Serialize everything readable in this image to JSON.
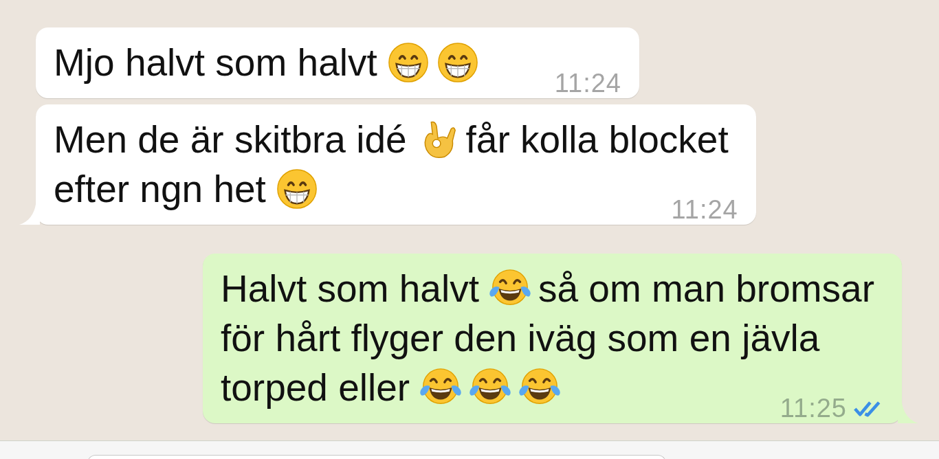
{
  "messages": [
    {
      "kind": "incoming",
      "tail": false,
      "time": "11:24",
      "lines": [
        [
          {
            "kind": "text",
            "text": "Mjo halvt som halvt"
          },
          {
            "kind": "grin"
          },
          {
            "kind": "grin"
          }
        ]
      ]
    },
    {
      "kind": "incoming",
      "tail": true,
      "time": "11:24",
      "lines": [
        [
          {
            "kind": "text",
            "text": "Men de är skitbra idé"
          },
          {
            "kind": "ok-hand"
          },
          {
            "kind": "text",
            "text": "får kolla blocket"
          }
        ],
        [
          {
            "kind": "text",
            "text": "efter ngn het"
          },
          {
            "kind": "grin"
          }
        ]
      ]
    },
    {
      "kind": "outgoing",
      "tail": true,
      "time": "11:25",
      "read": true,
      "lines": [
        [
          {
            "kind": "text",
            "text": "Halvt som halvt"
          },
          {
            "kind": "tears-of-joy"
          },
          {
            "kind": "text",
            "text": "så om man bromsar"
          }
        ],
        [
          {
            "kind": "text",
            "text": "för hårt flyger den iväg som en jävla"
          }
        ],
        [
          {
            "kind": "text",
            "text": "torped eller"
          },
          {
            "kind": "tears-of-joy"
          },
          {
            "kind": "tears-of-joy"
          },
          {
            "kind": "tears-of-joy"
          }
        ]
      ]
    }
  ]
}
